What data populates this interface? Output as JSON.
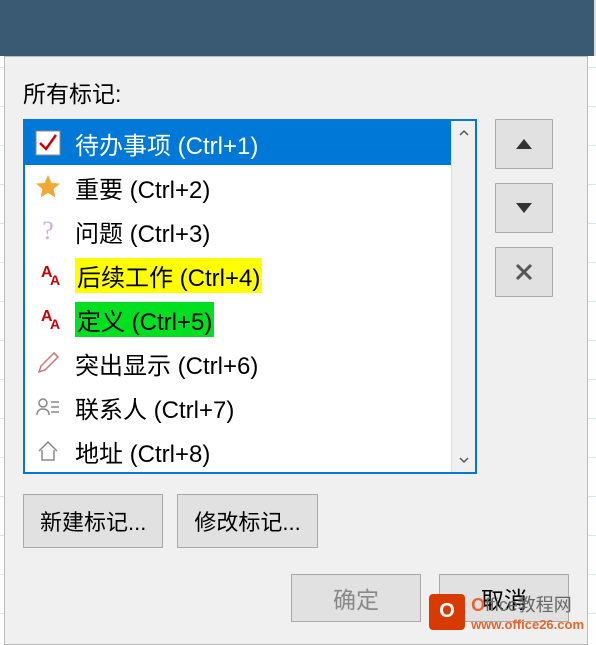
{
  "label": "所有标记:",
  "items": [
    {
      "name": "待办事项 (Ctrl+1)",
      "icon": "checkmark"
    },
    {
      "name": "重要 (Ctrl+2)",
      "icon": "star"
    },
    {
      "name": "问题 (Ctrl+3)",
      "icon": "question"
    },
    {
      "name": "后续工作 (Ctrl+4)",
      "icon": "aa",
      "highlight": "yellow"
    },
    {
      "name": "定义 (Ctrl+5)",
      "icon": "aa",
      "highlight": "green"
    },
    {
      "name": "突出显示 (Ctrl+6)",
      "icon": "pen"
    },
    {
      "name": "联系人 (Ctrl+7)",
      "icon": "contact"
    },
    {
      "name": "地址 (Ctrl+8)",
      "icon": "home"
    }
  ],
  "buttons": {
    "new_tag": "新建标记...",
    "modify_tag": "修改标记...",
    "ok": "确定",
    "cancel": "取消"
  },
  "watermark": {
    "brand_o": "O",
    "brand_rest": "ffice教程网",
    "url": "www.office26.com",
    "logo": "O"
  }
}
